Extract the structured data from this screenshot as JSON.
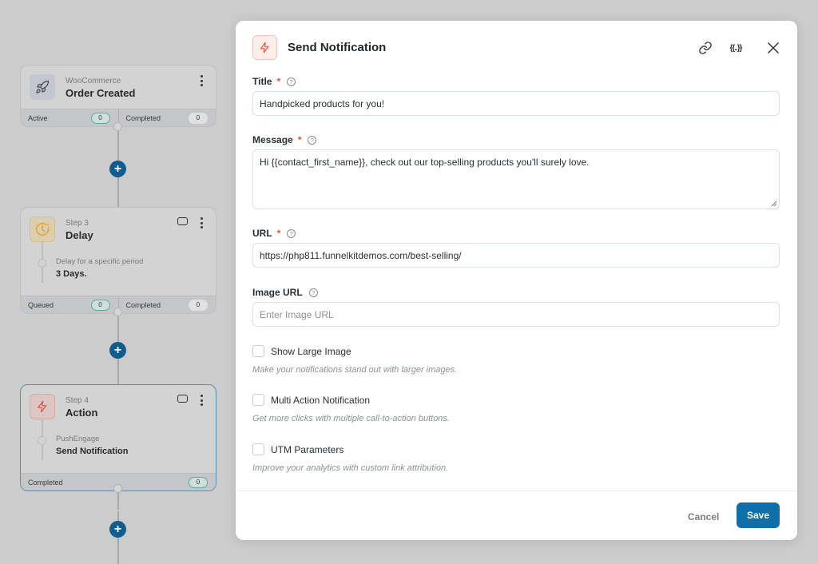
{
  "canvas": {
    "nodes": [
      {
        "subtitle": "WooCommerce",
        "title": "Order Created",
        "icon": "rocket-icon",
        "stats": [
          {
            "label": "Active",
            "value": "0"
          },
          {
            "label": "Completed",
            "value": "0"
          }
        ]
      },
      {
        "subtitle": "Step 3",
        "title": "Delay",
        "icon": "clock-icon",
        "detail_label": "Delay for a specific period",
        "detail_value": "3 Days.",
        "stats": [
          {
            "label": "Queued",
            "value": "0"
          },
          {
            "label": "Completed",
            "value": "0"
          }
        ]
      },
      {
        "subtitle": "Step 4",
        "title": "Action",
        "icon": "lightning-icon",
        "detail_label": "PushEngage",
        "detail_value": "Send Notification",
        "stats": [
          {
            "label": "Completed",
            "value": "0"
          }
        ]
      }
    ],
    "add_button_glyph": "+"
  },
  "modal": {
    "title": "Send Notification",
    "icon": "lightning-icon",
    "header_actions": {
      "link": "link-icon",
      "merge_tags": "{{..}}",
      "close": "close-icon"
    },
    "fields": {
      "title": {
        "label": "Title",
        "required": "*",
        "value": "Handpicked products for you!"
      },
      "message": {
        "label": "Message",
        "required": "*",
        "value": "Hi {{contact_first_name}}, check out our top-selling products you'll surely love."
      },
      "url": {
        "label": "URL",
        "required": "*",
        "value": "https://php811.funnelkitdemos.com/best-selling/"
      },
      "image_url": {
        "label": "Image URL",
        "value": "",
        "placeholder": "Enter Image URL"
      }
    },
    "checkboxes": [
      {
        "label": "Show Large Image",
        "checked": false,
        "hint": "Make your notifications stand out with larger images."
      },
      {
        "label": "Multi Action Notification",
        "checked": false,
        "hint": "Get more clicks with multiple call-to-action buttons."
      },
      {
        "label": "UTM Parameters",
        "checked": false,
        "hint": "Improve your analytics with custom link attribution."
      }
    ],
    "footer": {
      "cancel_label": "Cancel",
      "save_label": "Save"
    }
  },
  "colors": {
    "primary": "#0f6fa8",
    "required": "#e5533d",
    "canvas_add": "#0e5d8e"
  }
}
